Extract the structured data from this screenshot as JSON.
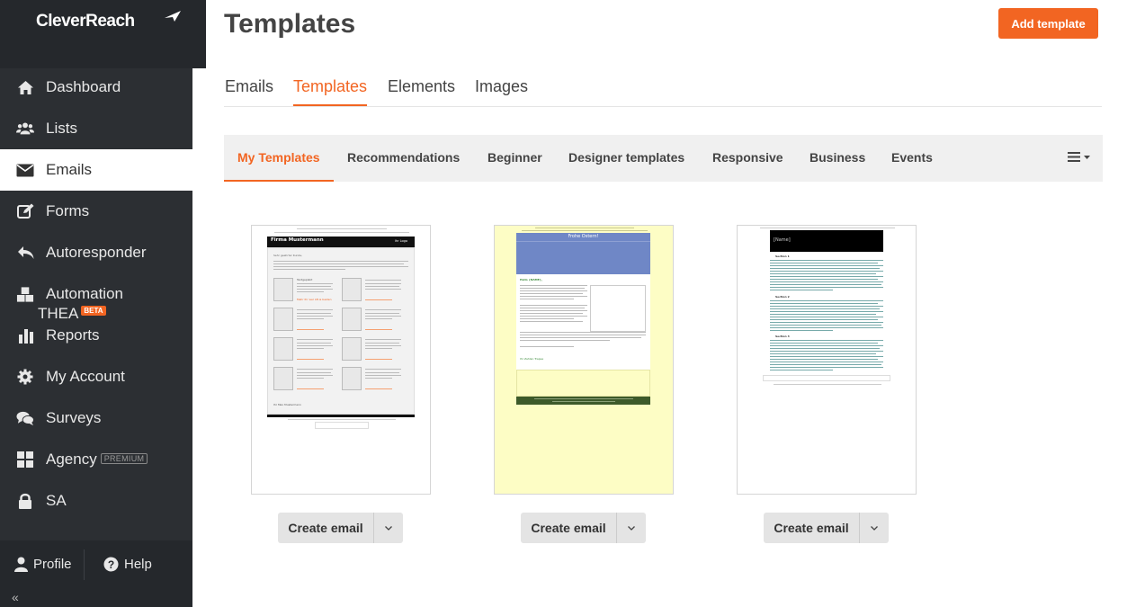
{
  "brand": {
    "name": "CleverReach"
  },
  "sidebar": {
    "items": [
      {
        "label": "Dashboard",
        "icon": "home-icon"
      },
      {
        "label": "Lists",
        "icon": "users-icon"
      },
      {
        "label": "Emails",
        "icon": "envelope-icon",
        "active": true
      },
      {
        "label": "Forms",
        "icon": "edit-icon"
      },
      {
        "label": "Autoresponder",
        "icon": "reply-icon"
      },
      {
        "label": "Automation",
        "icon": "cubes-icon"
      },
      {
        "label": "THEA",
        "badge": "BETA"
      },
      {
        "label": "Reports",
        "icon": "bar-chart-icon"
      },
      {
        "label": "My Account",
        "icon": "gear-icon"
      },
      {
        "label": "Surveys",
        "icon": "comments-icon"
      },
      {
        "label": "Agency",
        "icon": "grid-icon",
        "badge": "PREMIUM"
      },
      {
        "label": "SA",
        "icon": "lock-icon"
      }
    ],
    "bottom": {
      "profile": "Profile",
      "help": "Help",
      "collapse": "«"
    }
  },
  "header": {
    "title": "Templates",
    "add_button": "Add template"
  },
  "tabs": [
    "Emails",
    "Templates",
    "Elements",
    "Images"
  ],
  "subtabs": [
    "My Templates",
    "Recommendations",
    "Beginner",
    "Designer templates",
    "Responsive",
    "Business",
    "Events"
  ],
  "templates": [
    {
      "create_label": "Create email",
      "preview": {
        "company": "Firma Mustermann",
        "logo": "Ihr Logo",
        "greeting": "Sehr geehrter Kunde,",
        "signature": "Ihr Max Mustermann",
        "item_title": "Textgeplakt",
        "item_link": "Mehr Ihr wer LB ia besten"
      }
    },
    {
      "create_label": "Create email",
      "preview": {
        "headline": "Frohe Ostern!",
        "greeting": "Hallo {NAME},",
        "signature": "Ihr Zahlan Trapsa"
      }
    },
    {
      "create_label": "Create email",
      "preview": {
        "name_field": "[Name]",
        "sections": [
          "Section 1",
          "Section 2",
          "Section 3"
        ]
      }
    }
  ],
  "colors": {
    "accent": "#f26522",
    "sidebar": "#2c2f33",
    "easter_header": "#6f87c6",
    "easter_bg": "#fdfdc5",
    "easter_footer": "#3d5a2a"
  }
}
